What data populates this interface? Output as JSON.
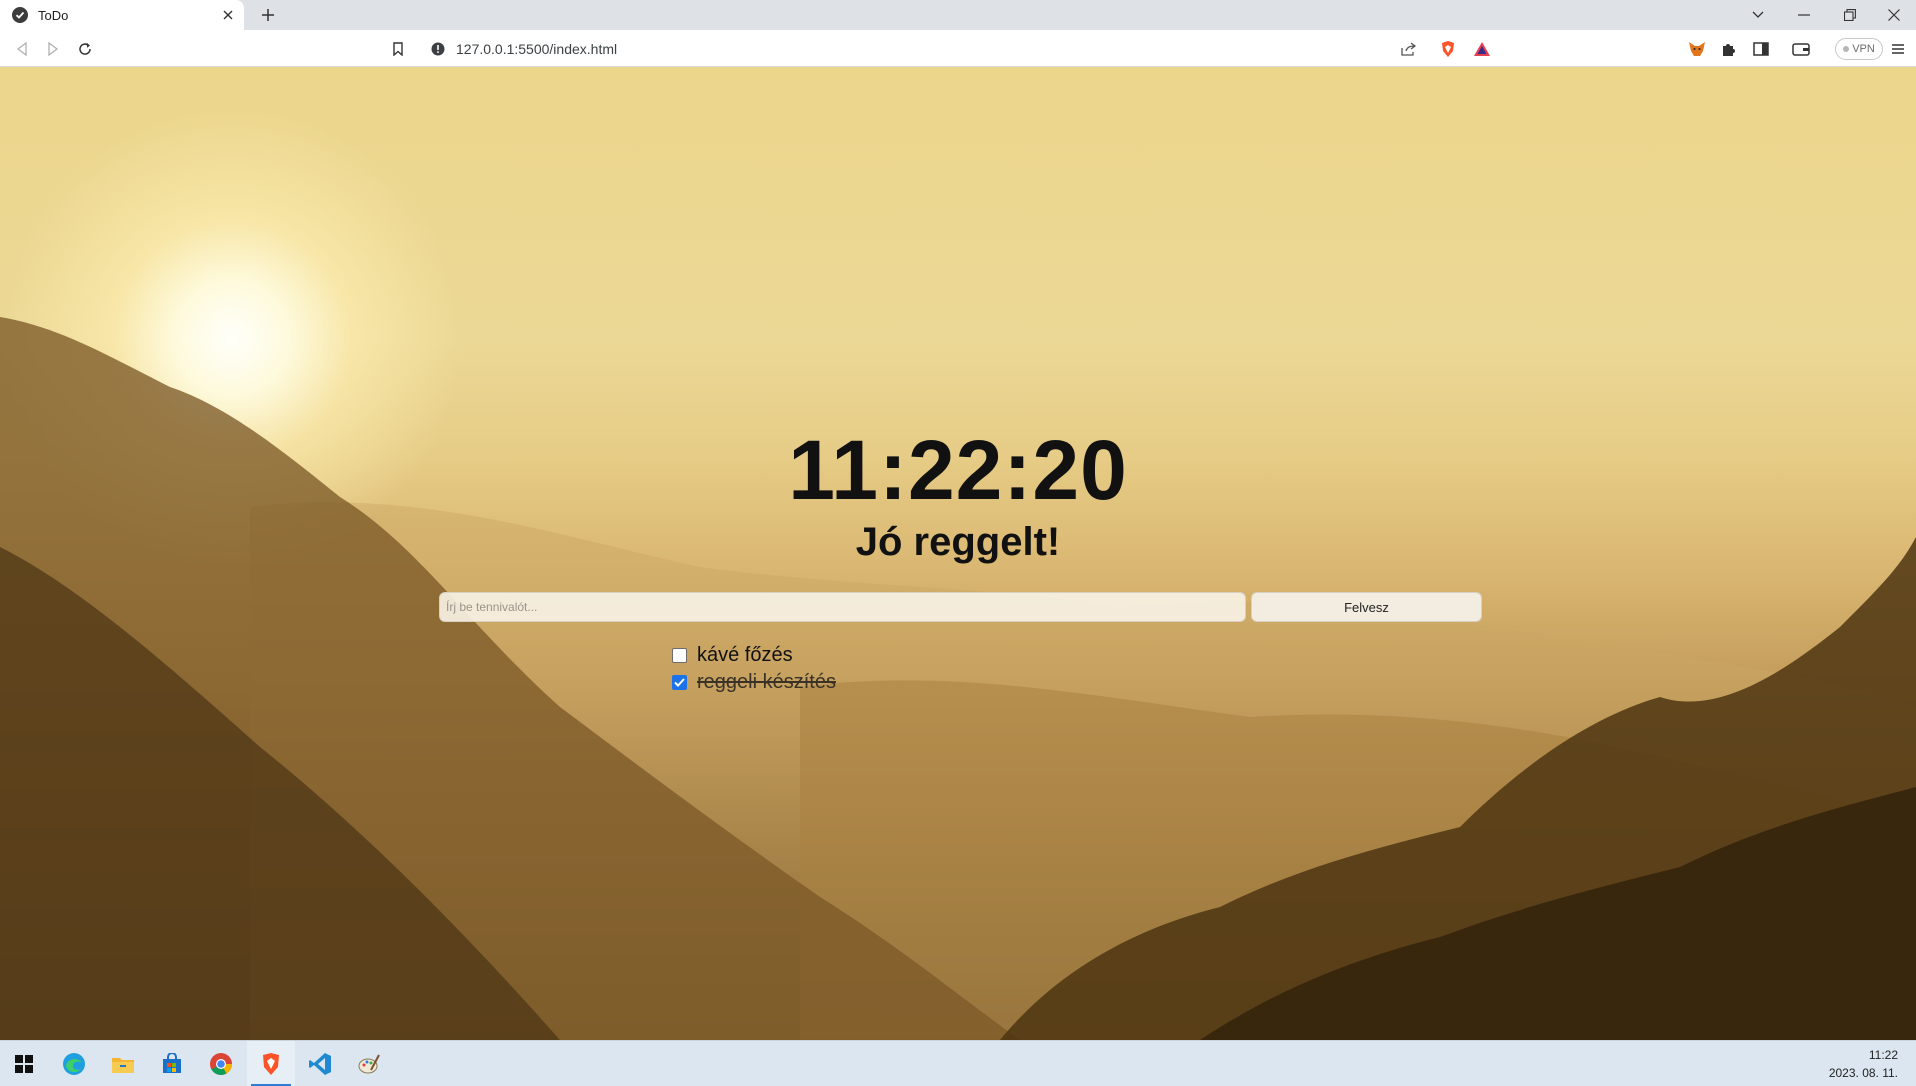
{
  "browser": {
    "tab": {
      "title": "ToDo"
    },
    "address": {
      "url": "127.0.0.1:5500/index.html"
    },
    "vpn_label": "VPN"
  },
  "page": {
    "clock": "11:22:20",
    "greeting": "Jó reggelt!",
    "input_placeholder": "Írj be tennivalót...",
    "add_button": "Felvesz",
    "todos": [
      {
        "text": "kávé főzés",
        "done": false
      },
      {
        "text": "reggeli készítés",
        "done": true
      }
    ]
  },
  "taskbar": {
    "apps": [
      "windows-start",
      "edge",
      "file-explorer",
      "microsoft-store",
      "chrome",
      "brave",
      "vscode",
      "paint"
    ],
    "active_app": "brave",
    "time": "11:22",
    "date": "2023. 08. 11."
  },
  "colors": {
    "checkbox_checked": "#1a73e8",
    "taskbar_accent": "#2f7cd6",
    "brave_orange": "#fb542b"
  }
}
